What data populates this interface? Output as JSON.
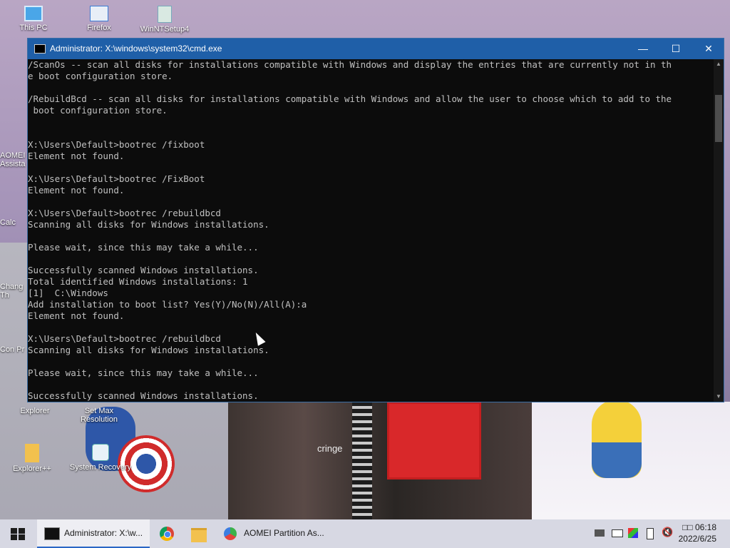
{
  "desktop": {
    "icons": [
      {
        "label": "This PC"
      },
      {
        "label": "Firefox"
      },
      {
        "label": "WinNTSetup4"
      },
      {
        "label": "AOMEI Assista"
      },
      {
        "label": "Calc"
      },
      {
        "label": "Chang Th"
      },
      {
        "label": "Con Pr"
      },
      {
        "label": "Explorer"
      },
      {
        "label": "Set Max Resolution"
      },
      {
        "label": "Explorer++"
      },
      {
        "label": "System Recovery"
      }
    ],
    "caption": "cringe"
  },
  "window": {
    "title": "Administrator: X:\\windows\\system32\\cmd.exe",
    "controls": {
      "minimize": "—",
      "maximize": "☐",
      "close": "✕"
    },
    "console_lines": [
      "/ScanOs -- scan all disks for installations compatible with Windows and display the entries that are currently not in th",
      "e boot configuration store.",
      "",
      "/RebuildBcd -- scan all disks for installations compatible with Windows and allow the user to choose which to add to the",
      " boot configuration store.",
      "",
      "",
      "X:\\Users\\Default>bootrec /fixboot",
      "Element not found.",
      "",
      "X:\\Users\\Default>bootrec /FixBoot",
      "Element not found.",
      "",
      "X:\\Users\\Default>bootrec /rebuildbcd",
      "Scanning all disks for Windows installations.",
      "",
      "Please wait, since this may take a while...",
      "",
      "Successfully scanned Windows installations.",
      "Total identified Windows installations: 1",
      "[1]  C:\\Windows",
      "Add installation to boot list? Yes(Y)/No(N)/All(A):a",
      "Element not found.",
      "",
      "X:\\Users\\Default>bootrec /rebuildbcd",
      "Scanning all disks for Windows installations.",
      "",
      "Please wait, since this may take a while...",
      "",
      "Successfully scanned Windows installations."
    ]
  },
  "taskbar": {
    "cmd_button": "Administrator: X:\\w...",
    "aomei_button": "AOMEI Partition As...",
    "clock_time": "06:18",
    "clock_prefix": "□□",
    "clock_date": "2022/6/25"
  },
  "colors": {
    "titlebar": "#1f5fa8",
    "console_bg": "#0c0c0c",
    "console_text": "#c0c0c0",
    "taskbar": "#d7d8e3"
  }
}
